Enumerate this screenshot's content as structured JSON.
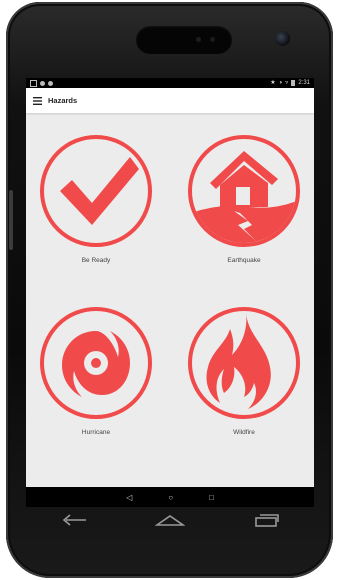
{
  "device": {
    "status_time": "2:31"
  },
  "appbar": {
    "title": "Hazards"
  },
  "hazards": [
    {
      "label": "Be Ready",
      "icon": "checkmark-icon"
    },
    {
      "label": "Earthquake",
      "icon": "earthquake-house-icon"
    },
    {
      "label": "Hurricane",
      "icon": "hurricane-icon"
    },
    {
      "label": "Wildfire",
      "icon": "wildfire-flame-icon"
    }
  ],
  "colors": {
    "accent": "#f04a4a",
    "background": "#ececec"
  },
  "navigation": {
    "soft_keys": [
      "back-triangle-icon",
      "home-circle-icon",
      "recents-square-icon"
    ],
    "hardware_keys": [
      "back-arrow-icon",
      "home-icon",
      "recent-apps-icon"
    ]
  }
}
